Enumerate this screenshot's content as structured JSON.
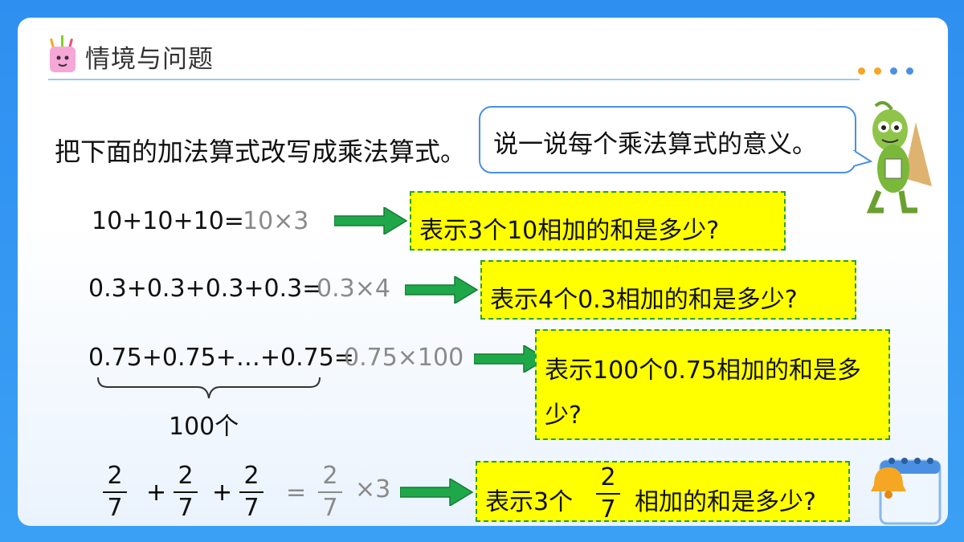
{
  "header": {
    "title": "情境与问题"
  },
  "instruction": "把下面的加法算式改写成乘法算式。",
  "bubble": {
    "text": "说一说每个乘法算式的意义。"
  },
  "rows": [
    {
      "expression": "10+10+10=",
      "answer": "10×3",
      "meaning": "表示3个10相加的和是多少?"
    },
    {
      "expression": "0.3+0.3+0.3+0.3=",
      "answer": "0.3×4",
      "meaning": "表示4个0.3相加的和是多少?"
    },
    {
      "expression": "0.75+0.75+…+0.75=",
      "answer": "0.75×100",
      "meaning_line1": "表示100个0.75相加的和是多",
      "meaning_line2": "少?",
      "brace_label": "100个"
    }
  ],
  "fraction_row": {
    "numerator": "2",
    "denominator": "7",
    "plus": "+",
    "equals": "=",
    "times": "×3",
    "meaning_prefix": "表示3个",
    "meaning_suffix": "相加的和是多少?"
  },
  "colors": {
    "frame": "#2f8ff0",
    "highlight": "#ffff00",
    "border_dash": "#2aa12a",
    "arrow": "#1fa84a",
    "answer_gray": "#8a8a8a",
    "dots": [
      "#f5a623",
      "#f5a623",
      "#4a90e2",
      "#4a90e2"
    ]
  }
}
